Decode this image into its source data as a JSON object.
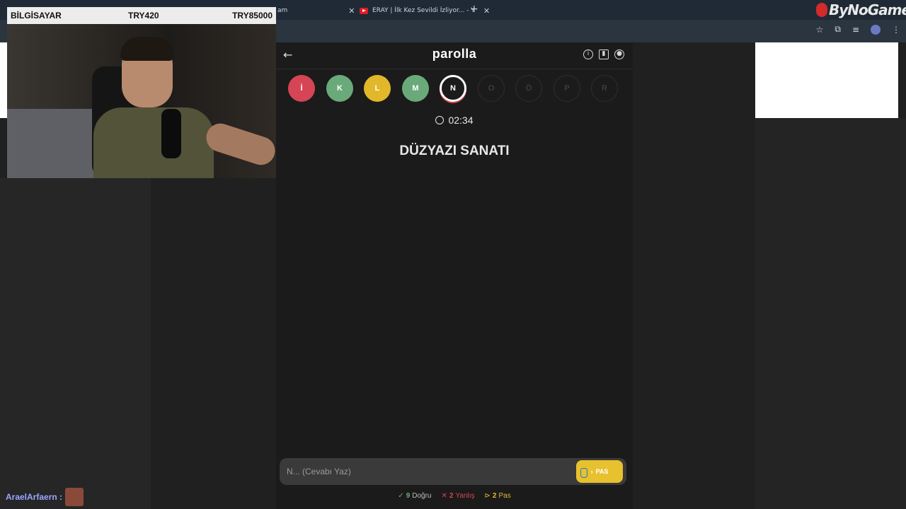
{
  "browser": {
    "tab1_fragment": "am",
    "tab2_title": "ERAY | İlk Kez Sevildi İzliyor... - Y",
    "new_tab": "+"
  },
  "overlay": {
    "logo": "ByNoGame",
    "stats": {
      "label": "BİLGİSAYAR",
      "middle": "TRY420",
      "right": "TRY85000"
    }
  },
  "game": {
    "brand": "parolla",
    "letters": [
      {
        "letter": "İ",
        "state": "wrong",
        "color": "#d64555"
      },
      {
        "letter": "K",
        "state": "correct",
        "color": "#6aaa7a"
      },
      {
        "letter": "L",
        "state": "passed",
        "color": "#e2b72a"
      },
      {
        "letter": "M",
        "state": "correct",
        "color": "#6aaa7a"
      },
      {
        "letter": "N",
        "state": "active",
        "color": "#ffffff"
      },
      {
        "letter": "O",
        "state": "pending",
        "color": "#2e2e2e"
      },
      {
        "letter": "Ö",
        "state": "pending",
        "color": "#2e2e2e"
      },
      {
        "letter": "P",
        "state": "pending",
        "color": "#2e2e2e"
      },
      {
        "letter": "R",
        "state": "pending",
        "color": "#2e2e2e"
      }
    ],
    "timer": "02:34",
    "question": "DÜZYAZI SANATI",
    "answer_placeholder": "N... (Cevabı Yaz)",
    "pass_label": "PAS",
    "score": {
      "correct_count": "9",
      "correct_label": "Doğru",
      "wrong_count": "2",
      "wrong_label": "Yanlış",
      "pass_count": "2",
      "pass_label": "Pas"
    },
    "colors": {
      "correct": "#6aaa7a",
      "wrong": "#d64555",
      "pass": "#e2b72a"
    }
  },
  "chat": {
    "user": "AraelArfaern :"
  }
}
